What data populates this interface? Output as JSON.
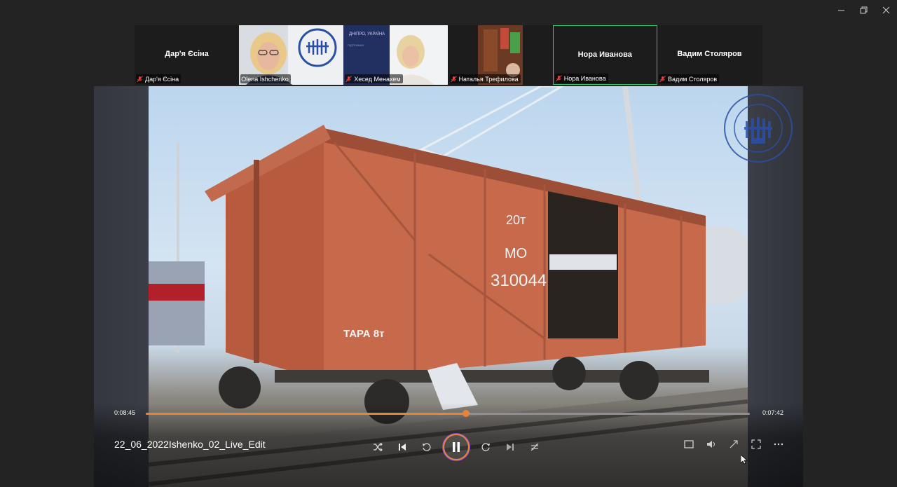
{
  "window_controls": {
    "minimize": "—",
    "restore": "❐",
    "close": "✕"
  },
  "participants": [
    {
      "center_name": "Дар'я Єсіна",
      "label": "Дар'я Єсіна",
      "video": false,
      "active": false
    },
    {
      "center_name": "",
      "label": "Olena Ishchenko",
      "video": true,
      "active": false
    },
    {
      "center_name": "",
      "label": "Хесед Менахем",
      "video": true,
      "active": false
    },
    {
      "center_name": "",
      "label": "Наталья Трефилова",
      "video": true,
      "active": false
    },
    {
      "center_name": "Нора Иванова",
      "label": "Нора Иванова",
      "video": false,
      "active": true
    },
    {
      "center_name": "Вадим Столяров",
      "label": "Вадим Столяров",
      "video": false,
      "active": false
    }
  ],
  "boxcar_text": {
    "capacity": "20т",
    "series": "МО",
    "number": "310044",
    "tare": "ТАРА 8т"
  },
  "player": {
    "current_time": "0:08:45",
    "total_time": "0:07:42",
    "progress": 0.53,
    "title": "22_06_2022Ishenko_02_Live_Edit"
  },
  "colors": {
    "accent": "#e8833a",
    "active_border": "#2ecc71",
    "mic_muted": "#e0433f"
  }
}
